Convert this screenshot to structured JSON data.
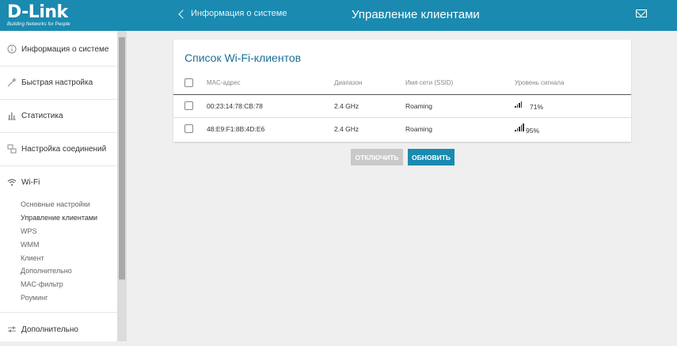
{
  "header": {
    "logo_text": "D-Link",
    "logo_subtitle": "Building Networks for People",
    "back_label": "Информация о системе",
    "title": "Управление клиентами",
    "accent_color": "#1a8ab0"
  },
  "sidebar": {
    "items": [
      {
        "label": "Информация о системе",
        "icon": "info-icon"
      },
      {
        "label": "Быстрая настройка",
        "icon": "magic-wand-icon"
      },
      {
        "label": "Статистика",
        "icon": "bar-chart-icon"
      },
      {
        "label": "Настройка соединений",
        "icon": "network-icon"
      },
      {
        "label": "Wi-Fi",
        "icon": "wifi-icon"
      },
      {
        "label": "Дополнительно",
        "icon": "sliders-icon"
      }
    ],
    "wifi_subitems": [
      "Основные настройки",
      "Управление клиентами",
      "WPS",
      "WMM",
      "Клиент",
      "Дополнительно",
      "MAC-фильтр",
      "Роуминг"
    ]
  },
  "card": {
    "title": "Список Wi-Fi-клиентов",
    "columns": [
      "MAC-адрес",
      "Диапазон",
      "Имя сети (SSID)",
      "Уровень сигнала"
    ],
    "rows": [
      {
        "mac": "00:23:14:78:CB:78",
        "band": "2.4 GHz",
        "ssid": "Roaming",
        "signal": "71%",
        "signal_level": 0.71
      },
      {
        "mac": "48:E9:F1:8B:4D:E6",
        "band": "2.4 GHz",
        "ssid": "Roaming",
        "signal": "95%",
        "signal_level": 0.95
      }
    ]
  },
  "buttons": {
    "disconnect": "ОТКЛЮЧИТЬ",
    "refresh": "ОБНОВИТЬ"
  }
}
